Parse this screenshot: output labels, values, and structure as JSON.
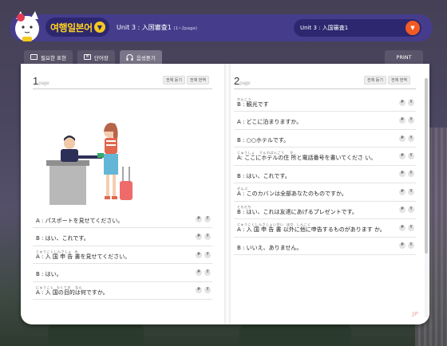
{
  "app": {
    "brand": "여행일본어",
    "unit_title": "Unit 3 : 入国審査1",
    "unit_pages": "(1~2page)",
    "unit_select_value": "Unit 3 : 入国審査1"
  },
  "tabs": [
    {
      "label": "필요한 표현",
      "icon": "chat-icon"
    },
    {
      "label": "단어장",
      "icon": "book-icon"
    },
    {
      "label": "음성듣기",
      "icon": "headphone-icon"
    }
  ],
  "print_label": "PRINT",
  "page_buttons": {
    "listen_all": "전체 듣기",
    "translate_all": "전체 번역"
  },
  "play_label": "P",
  "translate_label": "T",
  "pages": [
    {
      "number": "1",
      "suffix": "page",
      "rows": [
        {
          "furi": "",
          "text": "A : パスポートを見せてください。"
        },
        {
          "furi": "",
          "text": "B : はい、これです。"
        },
        {
          "furi": "じゅうこくしんさしょ  み",
          "text": "A : 入 国 申 告 書を見せてください。"
        },
        {
          "furi": "",
          "text": "B : はい。"
        },
        {
          "furi": "にゅうこく  もくてき   なん",
          "text": "A : 入 国の目的は何ですか。"
        }
      ]
    },
    {
      "number": "2",
      "suffix": "page",
      "rows": [
        {
          "furi": "かんこう",
          "text": "B : 観光です"
        },
        {
          "furi": "",
          "text": "A : どこに泊まりますか。"
        },
        {
          "furi": "",
          "text": "B : ○○ホテルです。"
        },
        {
          "furi": "じゅうしょ   でんわばんごう    か",
          "text": "A: ここにホテルの住 所と電話番号を書いてくださ い。"
        },
        {
          "furi": "",
          "text": "B : はい、これです。"
        },
        {
          "furi": "ぜんぶ",
          "text": "A : このカバンは全部あなたのものですか。"
        },
        {
          "furi": "ともだち",
          "text": "B : はい、これは友達にあげるプレゼントです。"
        },
        {
          "furi": "じゅうこくしんさしょいがい  ほか  しんこく",
          "text": "A : 入 国 申 告 書 以外に他に申告するものがあります か。"
        },
        {
          "furi": "",
          "text": "B : いいえ、ありません。"
        }
      ]
    }
  ],
  "colors": {
    "topbar": "#453d8b",
    "brand_text": "#ffd21e",
    "accent": "#f15a22"
  }
}
